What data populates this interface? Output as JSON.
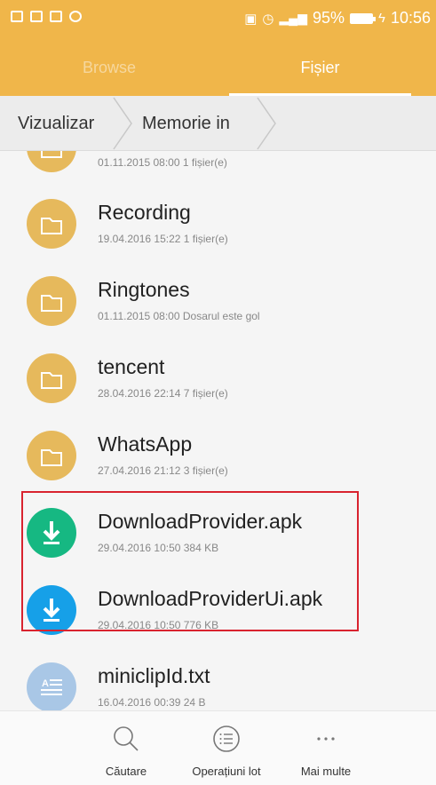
{
  "status_bar": {
    "signal": "95%",
    "time": "10:56"
  },
  "tabs": [
    {
      "label": "Browse",
      "active": false
    },
    {
      "label": "Fișier",
      "active": true
    }
  ],
  "breadcrumb": [
    "Vizualizar",
    "Memorie in"
  ],
  "files": [
    {
      "name": "",
      "meta": "01.11.2015 08:00  1 fișier(e)",
      "icon": "folder-icon"
    },
    {
      "name": "Recording",
      "meta": "19.04.2016 15:22  1 fișier(e)",
      "icon": "folder-icon"
    },
    {
      "name": "Ringtones",
      "meta": "01.11.2015 08:00  Dosarul este gol",
      "icon": "folder-icon"
    },
    {
      "name": "tencent",
      "meta": "28.04.2016 22:14  7 fișier(e)",
      "icon": "folder-icon"
    },
    {
      "name": "WhatsApp",
      "meta": "27.04.2016 21:12  3 fișier(e)",
      "icon": "folder-icon"
    },
    {
      "name": "DownloadProvider.apk",
      "meta": "29.04.2016 10:50  384 KB",
      "icon": "apk-download-icon"
    },
    {
      "name": "DownloadProviderUi.apk",
      "meta": "29.04.2016 10:50  776 KB",
      "icon": "apk-download-icon"
    },
    {
      "name": "miniclipId.txt",
      "meta": "16.04.2016 00:39  24 B",
      "icon": "text-file-icon"
    }
  ],
  "toolbar": {
    "search_label": "Căutare",
    "batch_label": "Operațiuni lot",
    "more_label": "Mai multe"
  },
  "colors": {
    "accent": "#f0b64a",
    "folder": "#e6b95c",
    "apk_green": "#16b882",
    "apk_blue": "#16a0e8",
    "highlight": "#d9232f"
  }
}
